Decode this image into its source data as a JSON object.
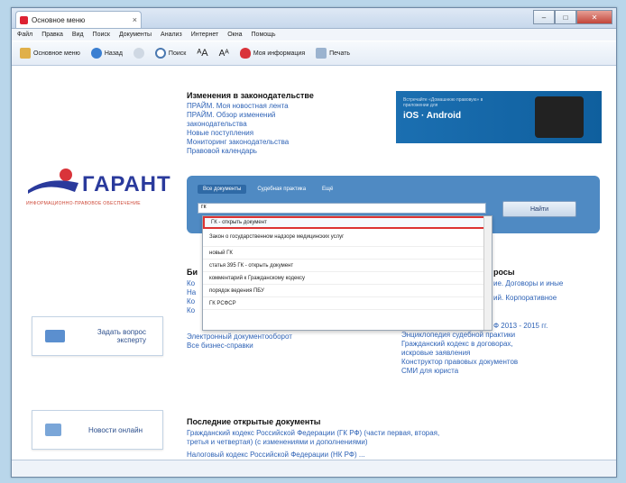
{
  "window": {
    "tab_title": "Основное меню",
    "tab_close": "×",
    "controls": {
      "minimize": "–",
      "maximize": "□",
      "close": "✕"
    }
  },
  "menubar": [
    "Файл",
    "Правка",
    "Вид",
    "Поиск",
    "Документы",
    "Анализ",
    "Интернет",
    "Окна",
    "Помощь"
  ],
  "toolbar": {
    "main_menu": "Основное меню",
    "back": "Назад",
    "find": "Поиск",
    "my_info": "Моя информация",
    "print_list": "Печать"
  },
  "changes": {
    "heading": "Изменения в законодательстве",
    "links": [
      "ПРАЙМ. Моя новостная лента",
      "ПРАЙМ. Обзор изменений",
      "законодательства",
      "Новые поступления",
      "Мониторинг законодательства",
      "Правовой календарь"
    ]
  },
  "banner": {
    "line1": "Встречайте «Домашнюю правовую» в приложении для",
    "line2": "iOS · Android"
  },
  "logo": {
    "text": "ГАРАНТ",
    "sub": "ИНФОРМАЦИОННО-ПРАВОВОЕ ОБЕСПЕЧЕНИЕ"
  },
  "search": {
    "tabs": [
      "Все документы",
      "Судебная практика",
      "Ещё"
    ],
    "value": "гк",
    "button": "Найти"
  },
  "dropdown": [
    "ГК - открыть документ",
    "Закон о государственном надзоре медицинских услуг",
    "новый ГК",
    "статья 395 ГК - открыть документ",
    "комментарий к Гражданскому кодексу",
    "порядок ведения ПБУ",
    "ГК РСФСР"
  ],
  "side_cards": {
    "expert": "Задать вопрос эксперту",
    "news": "Новости онлайн"
  },
  "left_section": {
    "heading": "Би",
    "lines": [
      "Ко",
      "На",
      "Ко",
      "Ко",
      "Электронный документооборот",
      "Все бизнес-справки"
    ]
  },
  "right_section": {
    "heading": "росы",
    "lines": [
      "ие. Договоры и иные",
      "ий. Корпоративное",
      "Ф 2013 - 2015 гг.",
      "Энциклопедия судебной практики",
      "Гражданский кодекс в договорах,",
      "искровые заявления",
      "Конструктор правовых документов",
      "СМИ для юриста"
    ]
  },
  "latest": {
    "heading": "Последние открытые документы",
    "items": [
      "Гражданский кодекс Российской Федерации (ГК РФ) (части первая, вторая,",
      "третья и четвертая) (с изменениями и дополнениями)",
      "Налоговый кодекс Российской Федерации (НК РФ) ..."
    ]
  }
}
